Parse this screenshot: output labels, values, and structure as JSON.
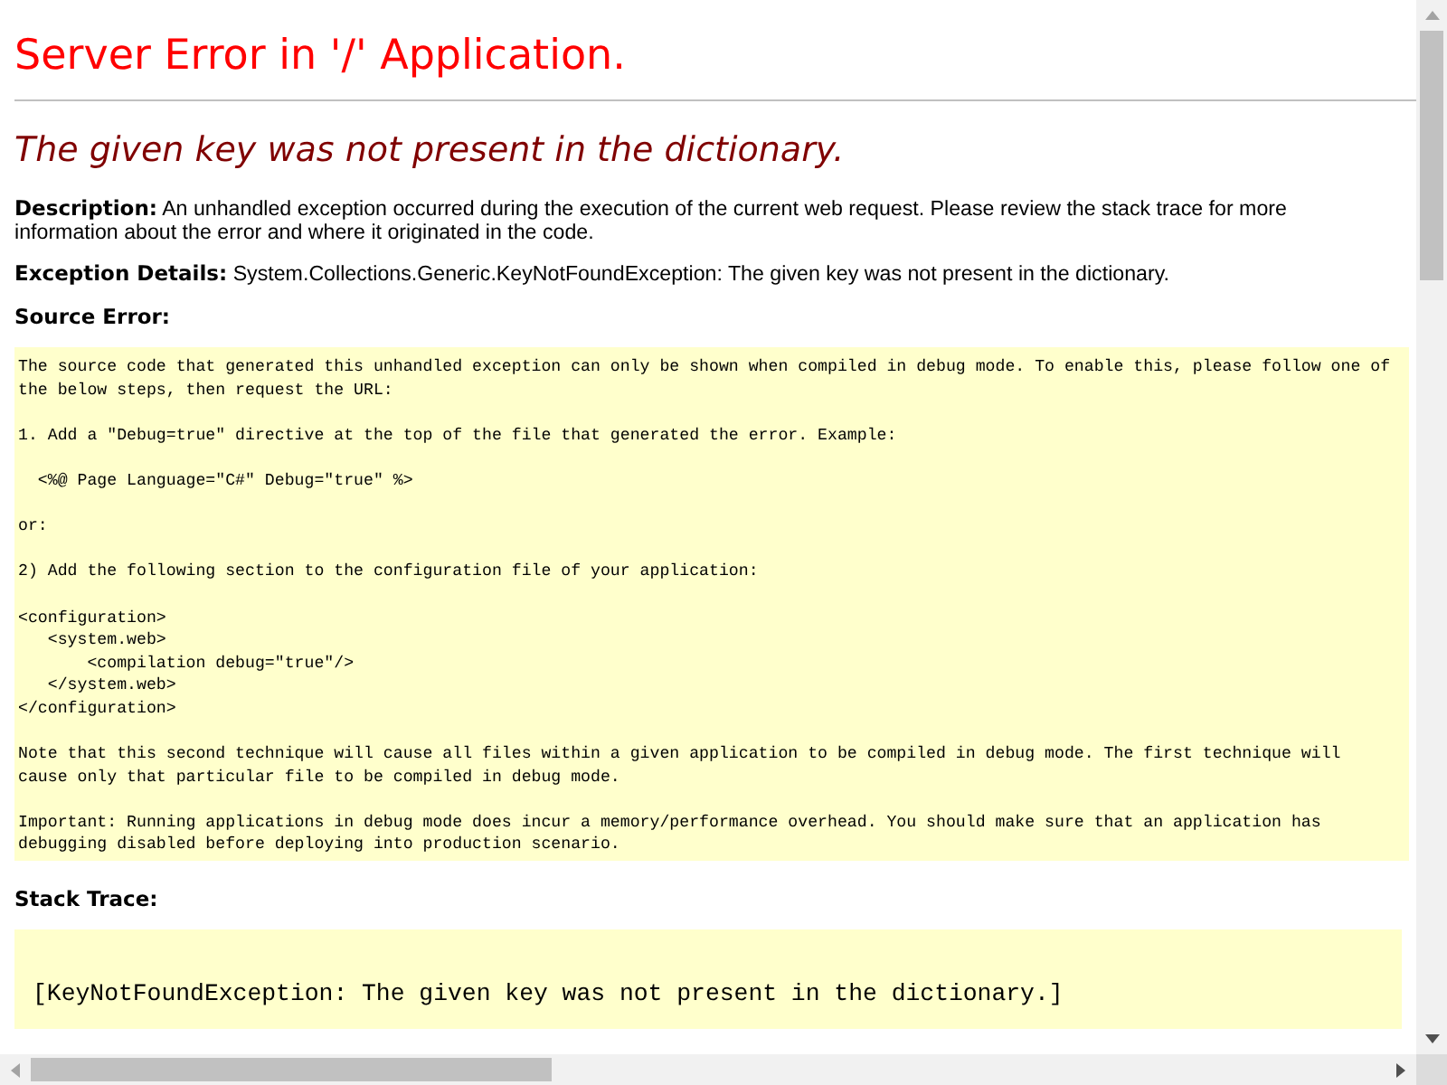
{
  "title": "Server Error in '/' Application.",
  "error_message": "The given key was not present in the dictionary.",
  "description": "**Description:** An unhandled exception occurred during the execution of the current web request. Please review the stack trace for more information about the error and where it originated in the code.",
  "exception_details": "**Exception Details:** System.Collections.Generic.KeyNotFoundException: The given key was not present in the dictionary.",
  "source_error": {
    "heading": "Source Error:",
    "paragraphs": [
      [
        "The source code that generated this unhandled exception can only be shown when compiled in debug mode. To enable this, please follow one of",
        "the below steps, then request the URL:"
      ],
      [
        "1. Add a \"Debug=true\" directive at the top of the file that generated the error. Example:"
      ],
      [
        "  <%@ Page Language=\"C#\" Debug=\"true\" %>"
      ],
      [
        "or:"
      ],
      [
        "2) Add the following section to the configuration file of your application:"
      ],
      [
        "<configuration>",
        "   <system.web>",
        "       <compilation debug=\"true\"/>",
        "   </system.web>",
        "</configuration>"
      ],
      [
        "Note that this second technique will cause all files within a given application to be compiled in debug mode. The first technique will",
        "cause only that particular file to be compiled in debug mode."
      ],
      [
        "Important: Running applications in debug mode does incur a memory/performance overhead. You should make sure that an application has",
        "debugging disabled before deploying into production scenario."
      ]
    ]
  },
  "stack_trace": {
    "heading": "Stack Trace:",
    "lines": [
      "[KeyNotFoundException: The given key was not present in the dictionary.]"
    ]
  }
}
